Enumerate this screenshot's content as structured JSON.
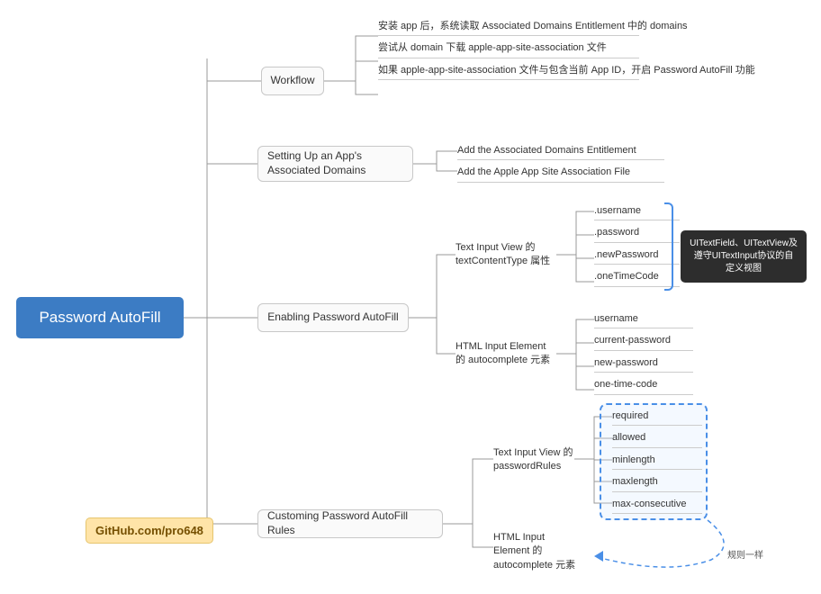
{
  "root": "Password AutoFill",
  "github": "GitHub.com/pro648",
  "n1": "Workflow",
  "n1_leaves": [
    "安装 app 后，系统读取 Associated Domains\nEntitlement 中的 domains",
    "尝试从 domain 下载 apple-app-site-association 文件",
    "如果 apple-app-site-association 文件与包含当前 App\nID，开启 Password AutoFill 功能"
  ],
  "n2": "Setting Up an App's Associated Domains",
  "n2_leaves": [
    "Add the Associated Domains Entitlement",
    "Add the Apple App Site Association File"
  ],
  "n3": "Enabling Password AutoFill",
  "n3a": "Text Input View 的 textContentType 属性",
  "n3a_leaves": [
    ".username",
    ".password",
    ".newPassword",
    ".oneTimeCode"
  ],
  "n3_tag": "UITextField、UITextView及遵守UITextInput协议的自定义视图",
  "n3b": "HTML Input Element 的 autocomplete 元素",
  "n3b_leaves": [
    "username",
    "current-password",
    "new-password",
    "one-time-code"
  ],
  "n4": "Customing Password AutoFill Rules",
  "n4a": "Text Input View 的 passwordRules",
  "n4a_leaves": [
    "required",
    "allowed",
    "minlength",
    "maxlength",
    "max-consecutive"
  ],
  "n4b": "HTML Input Element 的 autocomplete 元素",
  "n4_anno": "规则一样"
}
